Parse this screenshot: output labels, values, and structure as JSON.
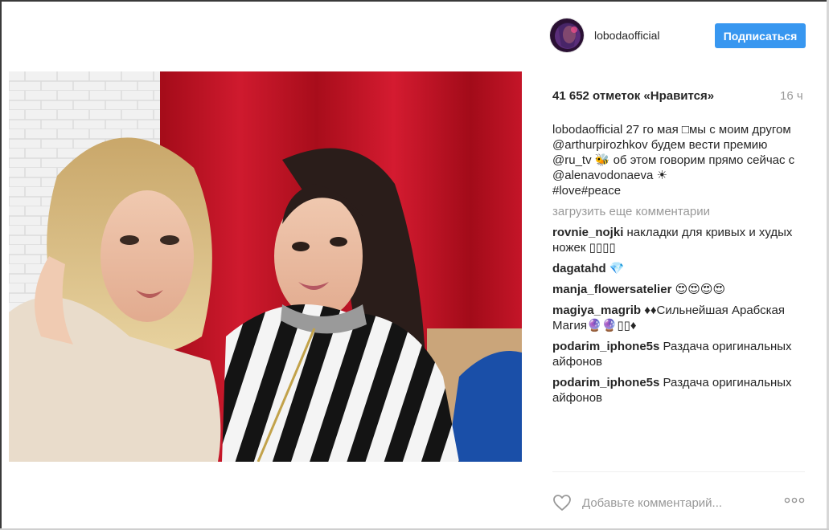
{
  "post": {
    "author": "lobodaofficial",
    "follow_label": "Подписаться",
    "likes_label": "41 652 отметок «Нравится»",
    "time_ago": "16 ч",
    "caption": {
      "user": "lobodaofficial",
      "text1": " 27 го мая □мы с моим другом ",
      "mention1": "@arthurpirozhkov",
      "text2": " будем вести премию ",
      "mention2": "@ru_tv",
      "text3": " 🐝 об этом говорим прямо сейчас с ",
      "mention3": "@alenavodonaeva",
      "text4": " ☀",
      "hashtags": "#love#peace"
    },
    "load_more_label": "загрузить еще комментарии",
    "comments": [
      {
        "user": "rovnie_nojki",
        "text": " накладки для кривых и худых ножек ▯▯▯▯"
      },
      {
        "user": "dagatahd",
        "text": " 💎"
      },
      {
        "user": "manja_flowersatelier",
        "text": " 😍😍😍😍"
      },
      {
        "user": "magiya_magrib",
        "text": " ♦♦Сильнейшая Арабская Магия🔮🔮▯▯♦"
      },
      {
        "user": "podarim_iphone5s",
        "text": " Раздача оригинальных айфонов"
      },
      {
        "user": "podarim_iphone5s",
        "text": " Раздача оригинальных айфонов"
      }
    ],
    "comment_placeholder": "Добавьте комментарий...",
    "more_icon": "ellipsis-icon",
    "like_icon": "heart-icon"
  },
  "colors": {
    "follow_button": "#3897f0",
    "link": "#003569",
    "muted": "#999999"
  }
}
